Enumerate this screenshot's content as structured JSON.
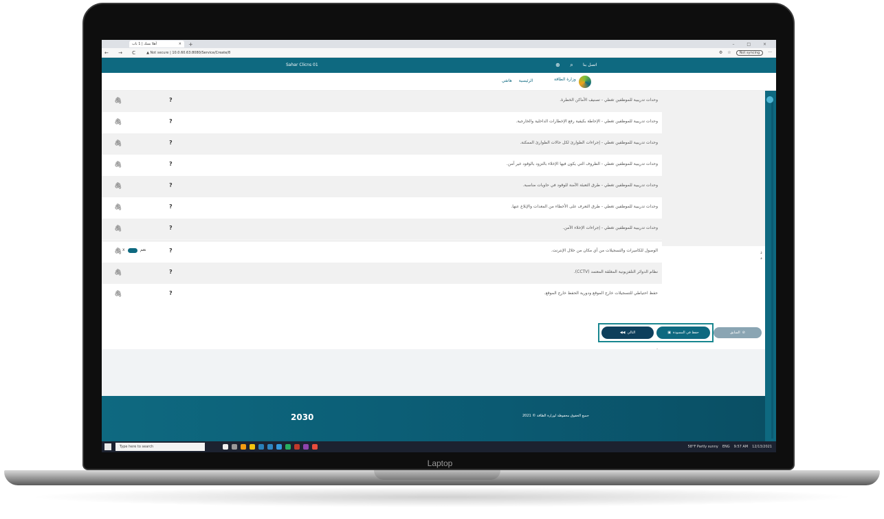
{
  "browser": {
    "tab_title": "أهلا بسك | 1 باب",
    "tab_close": "×",
    "new_tab": "+",
    "nav_buttons": "← → C",
    "security": "▲ Not secure",
    "url": "10.0.60.63:8080/Service/Create/8",
    "window_controls": "– □ ×",
    "signin_label": "Not syncing",
    "menu_dots": "···"
  },
  "header": {
    "user_name": "Sahar Clicns 01",
    "contact": "اتصل بنا"
  },
  "navbar": {
    "logo_text": "وزارة الطاقة",
    "menu_home": "الرئيسية",
    "menu_my_tasks": "هاتفي"
  },
  "rows": [
    {
      "text": "وحدات تدريبية للموظفين تغطي - تصنيف الأماكن الخطرة.",
      "q": "?"
    },
    {
      "text": "وحدات تدريبية للموظفين تغطي - الإحاطة بكيفية رفع الإخطارات الداخلية والخارجية.",
      "q": "?"
    },
    {
      "text": "وحدات تدريبية للموظفين تغطي - إجراءات الطوارئ لكل حالات الطوارئ الممكنة.",
      "q": "?"
    },
    {
      "text": "وحدات تدريبية للموظفين تغطي - الظروف التي يكون فيها الإخلاء بالتزود بالوقود غير آمن.",
      "q": "?"
    },
    {
      "text": "وحدات تدريبية للموظفين تغطي - طرق التعبئة الآمنة للوقود في حاويات مناسبة.",
      "q": "?"
    },
    {
      "text": "وحدات تدريبية للموظفين تغطي - طرق التعرف على الأخطاء من المعدات والإبلاغ عنها.",
      "q": "?"
    },
    {
      "text": "وحدات تدريبية للموظفين تغطي - إجراءات الإخلاء الآمن.",
      "q": "?"
    },
    {
      "text": "الوصول للكاميرات والتسجيلات من أي مكان من خلال الإنترنت.",
      "q": "?",
      "toggle_label": "نعم",
      "toggle_mark": "x"
    },
    {
      "text": "نظام الدوائر التلفزيونية المغلقة المعتمد (CCTV).",
      "q": "?"
    },
    {
      "text": "حفظ احتياطي للتسجيلات خارج الموقع ودورية الحفظ خارج الموقع.",
      "q": "?"
    }
  ],
  "side_marks": "ذ\nد",
  "buttons": {
    "save_draft": "حفظ في المسودة",
    "next": "التالي",
    "previous": "السابق"
  },
  "footer": {
    "copyright": "جميع الحقوق محفوظة لوزارة الطاقة © 2021",
    "vision": "2030"
  },
  "taskbar": {
    "search_placeholder": "Type here to search",
    "weather": "58°F Partly sunny",
    "lang": "ENG",
    "time": "9:57 AM",
    "date": "12/13/2021"
  },
  "laptop_label": "Laptop",
  "colors": {
    "brand": "#0e6980",
    "button_dark": "#0e3f5c",
    "button_disabled": "#8aa5b3",
    "highlight": "#17868f"
  }
}
